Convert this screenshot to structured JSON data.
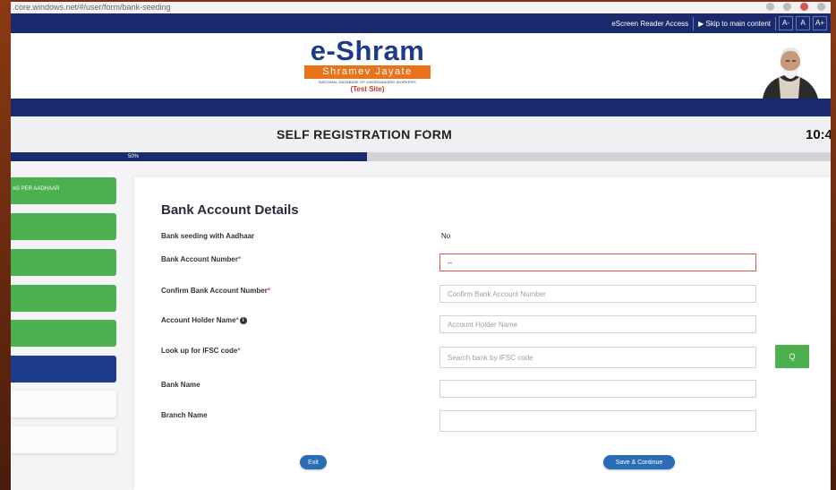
{
  "browser": {
    "url": ".core.windows.net/#/user/form/bank-seeding"
  },
  "topnav": {
    "screen_reader": "eScreen Reader Access",
    "skip": "Skip to main content",
    "font_small": "A-",
    "font_normal": "A",
    "font_large": "A+"
  },
  "header": {
    "logo_title": "e-Shram",
    "logo_tagline": "Shramev Jayate",
    "logo_subtitle": "NATIONAL DATABASE OF UNORGANISED WORKERS",
    "logo_test": "(Test Site)"
  },
  "form": {
    "title": "SELF REGISTRATION FORM",
    "clock": "10:4",
    "progress_label": "50%",
    "progress_value": 0.5
  },
  "sidebar": {
    "items": [
      {
        "label": "AS PER AADHAAR",
        "state": "completed"
      },
      {
        "label": "",
        "state": "completed"
      },
      {
        "label": "",
        "state": "completed"
      },
      {
        "label": "",
        "state": "completed"
      },
      {
        "label": "",
        "state": "completed"
      },
      {
        "label": "",
        "state": "active"
      },
      {
        "label": "",
        "state": "pending"
      },
      {
        "label": "",
        "state": "pending"
      }
    ]
  },
  "bank": {
    "section_title": "Bank Account Details",
    "seeding_label": "Bank seeding with Aadhaar",
    "seeding_value": "No",
    "account_number_label": "Bank Account Number",
    "account_number_value": "--",
    "confirm_label": "Confirm Bank Account Number",
    "confirm_placeholder": "Confirm Bank Account Number",
    "holder_label": "Account Holder Name",
    "holder_placeholder": "Account Holder Name",
    "ifsc_label": "Look up for IFSC code",
    "ifsc_placeholder": "Search bank by IFSC code",
    "bank_name_label": "Bank Name",
    "branch_name_label": "Branch Name",
    "required_mark": "*",
    "info_mark": "i",
    "search_icon": "magnifier-icon",
    "search_glyph": "Q"
  },
  "buttons": {
    "exit": "Exit",
    "save_continue": "Save & Continue"
  },
  "colors": {
    "navy": "#1a2a6c",
    "green": "#4caf50",
    "orange": "#e8731c",
    "button_blue": "#2a6db5",
    "error_red": "#d9534f"
  }
}
